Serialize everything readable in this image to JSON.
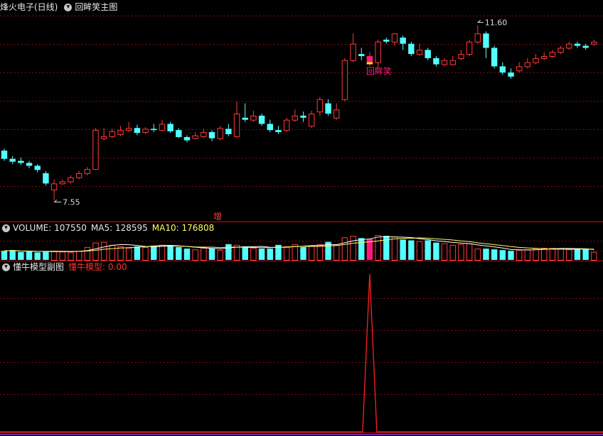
{
  "main_header": {
    "title": "烽火电子(日线)",
    "indicator": "回眸笑主图"
  },
  "vol_header": {
    "vol_label": "VOLUME: 107550",
    "ma5_label": "MA5: 128595",
    "ma10_label": "MA10: 176808"
  },
  "sub_header": {
    "title": "懂牛模型副图",
    "value_label": "懂牛模型: 0.00"
  },
  "annotations": {
    "high_label": "11.60",
    "low_label": "7.55",
    "signal_label": "回眸笑",
    "bottom_marker": "增"
  },
  "colors": {
    "up": "#ff3a3a",
    "down": "#54ffff",
    "signal_bar": "#ff1a7a",
    "ma5": "#ffffff",
    "ma10": "#ffff66",
    "sub_line": "#ff2020",
    "grid": "#7a1010"
  },
  "chart_data": [
    {
      "type": "candlestick",
      "title": "烽火电子(日线)",
      "ylim": [
        7.3,
        12.0
      ],
      "high": 11.6,
      "low": 7.55,
      "candles": [
        [
          8.75,
          8.55,
          8.8,
          8.5
        ],
        [
          8.55,
          8.48,
          8.62,
          8.42
        ],
        [
          8.5,
          8.45,
          8.58,
          8.4
        ],
        [
          8.45,
          8.38,
          8.5,
          8.32
        ],
        [
          8.38,
          8.28,
          8.42,
          8.22
        ],
        [
          8.2,
          7.95,
          8.25,
          7.9
        ],
        [
          7.8,
          7.95,
          8.05,
          7.55
        ],
        [
          7.95,
          8.0,
          8.05,
          7.92
        ],
        [
          8.0,
          8.1,
          8.15,
          7.95
        ],
        [
          8.1,
          8.2,
          8.25,
          8.05
        ],
        [
          8.2,
          8.3,
          8.35,
          8.15
        ],
        [
          8.3,
          9.25,
          9.3,
          8.28
        ],
        [
          9.05,
          9.1,
          9.3,
          9.0
        ],
        [
          9.1,
          9.22,
          9.28,
          9.05
        ],
        [
          9.15,
          9.25,
          9.35,
          9.1
        ],
        [
          9.25,
          9.3,
          9.45,
          9.2
        ],
        [
          9.3,
          9.18,
          9.38,
          9.12
        ],
        [
          9.2,
          9.28,
          9.32,
          9.15
        ],
        [
          9.28,
          9.25,
          9.4,
          9.2
        ],
        [
          9.25,
          9.4,
          9.5,
          9.22
        ],
        [
          9.4,
          9.22,
          9.45,
          9.18
        ],
        [
          9.25,
          9.08,
          9.3,
          9.05
        ],
        [
          9.08,
          9.0,
          9.12,
          8.95
        ],
        [
          9.05,
          9.12,
          9.2,
          9.02
        ],
        [
          9.1,
          9.2,
          9.28,
          9.05
        ],
        [
          9.2,
          9.05,
          9.25,
          8.98
        ],
        [
          9.05,
          9.3,
          9.35,
          9.0
        ],
        [
          9.28,
          9.15,
          9.4,
          9.1
        ],
        [
          9.1,
          9.65,
          9.95,
          9.05
        ],
        [
          9.55,
          9.5,
          9.9,
          9.45
        ],
        [
          9.5,
          9.6,
          9.72,
          9.45
        ],
        [
          9.6,
          9.4,
          9.65,
          9.35
        ],
        [
          9.4,
          9.25,
          9.5,
          9.2
        ],
        [
          9.25,
          9.2,
          9.35,
          9.15
        ],
        [
          9.25,
          9.5,
          9.55,
          9.2
        ],
        [
          9.5,
          9.6,
          9.75,
          9.45
        ],
        [
          9.6,
          9.55,
          9.7,
          9.45
        ],
        [
          9.35,
          9.65,
          9.72,
          9.3
        ],
        [
          9.7,
          10.0,
          10.05,
          9.6
        ],
        [
          9.9,
          9.65,
          10.0,
          9.6
        ],
        [
          9.55,
          9.75,
          9.9,
          9.5
        ],
        [
          10.0,
          10.95,
          11.0,
          9.95
        ],
        [
          10.95,
          11.35,
          11.6,
          10.9
        ],
        [
          11.1,
          11.05,
          11.25,
          10.95
        ],
        [
          11.05,
          10.85,
          11.15,
          10.8
        ],
        [
          10.9,
          11.4,
          11.45,
          10.75
        ],
        [
          11.45,
          11.4,
          11.5,
          11.35
        ],
        [
          11.4,
          11.6,
          11.6,
          11.3
        ],
        [
          11.5,
          11.35,
          11.55,
          11.2
        ],
        [
          11.35,
          11.1,
          11.4,
          11.05
        ],
        [
          11.1,
          11.2,
          11.35,
          11.05
        ],
        [
          11.2,
          11.0,
          11.25,
          10.95
        ],
        [
          11.0,
          10.85,
          11.05,
          10.8
        ],
        [
          10.85,
          10.95,
          11.0,
          10.8
        ],
        [
          10.85,
          10.95,
          11.05,
          10.82
        ],
        [
          11.0,
          11.1,
          11.2,
          10.95
        ],
        [
          11.1,
          11.4,
          11.45,
          11.05
        ],
        [
          11.4,
          11.6,
          11.8,
          11.35
        ],
        [
          11.6,
          11.25,
          11.65,
          11.0
        ],
        [
          11.25,
          10.8,
          11.3,
          10.75
        ],
        [
          10.8,
          10.65,
          10.9,
          10.6
        ],
        [
          10.65,
          10.55,
          10.75,
          10.5
        ],
        [
          10.7,
          10.8,
          10.9,
          10.65
        ],
        [
          10.8,
          10.9,
          11.0,
          10.75
        ],
        [
          10.9,
          11.0,
          11.1,
          10.85
        ],
        [
          11.0,
          11.05,
          11.15,
          10.95
        ],
        [
          11.05,
          11.15,
          11.2,
          11.0
        ],
        [
          11.15,
          11.25,
          11.3,
          11.1
        ],
        [
          11.25,
          11.35,
          11.4,
          11.2
        ],
        [
          11.35,
          11.3,
          11.4,
          11.25
        ],
        [
          11.3,
          11.25,
          11.35,
          11.2
        ],
        [
          11.35,
          11.4,
          11.45,
          11.3
        ]
      ],
      "signal_index": 44
    },
    {
      "type": "bar",
      "title": "VOLUME",
      "series": [
        {
          "name": "VOLUME",
          "values": [
            120000,
            130000,
            105000,
            110000,
            100000,
            115000,
            120000,
            110000,
            100000,
            120000,
            170000,
            230000,
            240000,
            200000,
            180000,
            160000,
            180000,
            170000,
            190000,
            200000,
            185000,
            170000,
            150000,
            140000,
            160000,
            150000,
            130000,
            210000,
            200000,
            180000,
            160000,
            150000,
            150000,
            200000,
            180000,
            210000,
            170000,
            190000,
            210000,
            240000,
            200000,
            300000,
            320000,
            290000,
            280000,
            330000,
            320000,
            310000,
            270000,
            260000,
            250000,
            260000,
            230000,
            220000,
            200000,
            210000,
            220000,
            150000,
            150000,
            140000,
            130000,
            120000,
            130000,
            140000,
            150000,
            160000,
            160000,
            150000,
            140000,
            140000,
            150000,
            107550
          ]
        },
        {
          "name": "MA5",
          "values": [
            128595
          ]
        },
        {
          "name": "MA10",
          "values": [
            176808
          ]
        }
      ]
    },
    {
      "type": "line",
      "title": "懂牛模型副图",
      "series": [
        {
          "name": "懂牛模型",
          "values": [
            0.0
          ],
          "spike_index": 44,
          "spike_value": 1.0
        }
      ]
    }
  ]
}
